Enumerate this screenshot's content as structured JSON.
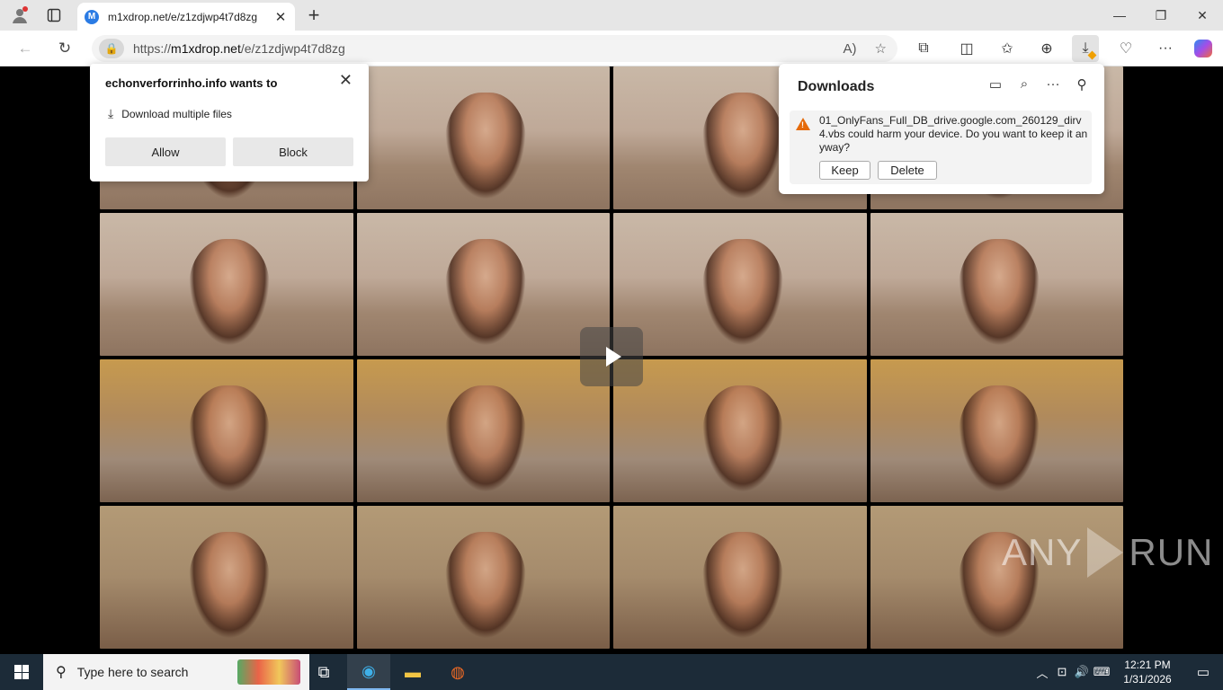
{
  "browser": {
    "tab": {
      "favicon_letter": "M",
      "title": "m1xdrop.net/e/z1zdjwp4t7d8zg",
      "close_glyph": "✕"
    },
    "new_tab_glyph": "+",
    "window_controls": {
      "minimize": "—",
      "maximize": "❐",
      "close": "✕"
    },
    "address": {
      "scheme": "https://",
      "host": "m1xdrop.net",
      "path": "/e/z1zdjwp4t7d8zg"
    },
    "icons": {
      "back": "←",
      "refresh": "↻",
      "lock": "🔒",
      "read_aloud": "A)",
      "favorite": "☆",
      "extensions": "⧉",
      "split": "◫",
      "favorites": "✩",
      "collections": "⊕",
      "downloads": "⤓",
      "performance": "♡",
      "more": "···"
    }
  },
  "permission_prompt": {
    "title": "echonverforrinho.info wants to",
    "request": "Download multiple files",
    "allow_label": "Allow",
    "block_label": "Block",
    "close_glyph": "✕",
    "download_glyph": "⤓"
  },
  "downloads_panel": {
    "title": "Downloads",
    "icons": {
      "folder": "▭",
      "search": "⌕",
      "more": "···",
      "pin": "⚲"
    },
    "item": {
      "message": "01_OnlyFans_Full_DB_drive.google.com_260129_dirv4.vbs could harm your device. Do you want to keep it anyway?",
      "keep_label": "Keep",
      "delete_label": "Delete",
      "warning_glyph": "!"
    }
  },
  "video": {
    "thumbnail_styles": [
      "t-sofa",
      "t-sofa",
      "t-sofa",
      "t-sofa",
      "t-sofa",
      "t-sofa",
      "t-sofa",
      "t-sofa",
      "t-warm",
      "t-warm",
      "t-warm",
      "t-warm",
      "t-close",
      "t-close",
      "t-close",
      "t-close"
    ]
  },
  "watermark": {
    "text_left": "ANY",
    "text_right": "RUN"
  },
  "taskbar": {
    "search_placeholder": "Type here to search",
    "search_glyph": "⚲",
    "apps": {
      "task_view": "⧉",
      "edge": "◉",
      "explorer": "▬",
      "firefox": "◍"
    },
    "tray": {
      "chevron": "︿",
      "network": "⊡",
      "volume": "🔊",
      "keyboard": "⌨"
    },
    "time": "12:21 PM",
    "date": "1/31/2026",
    "notification_glyph": "▭"
  },
  "colors": {
    "edge_blue": "#2a7be4",
    "warning_orange": "#e56a0a",
    "taskbar": "#1c2b38"
  }
}
